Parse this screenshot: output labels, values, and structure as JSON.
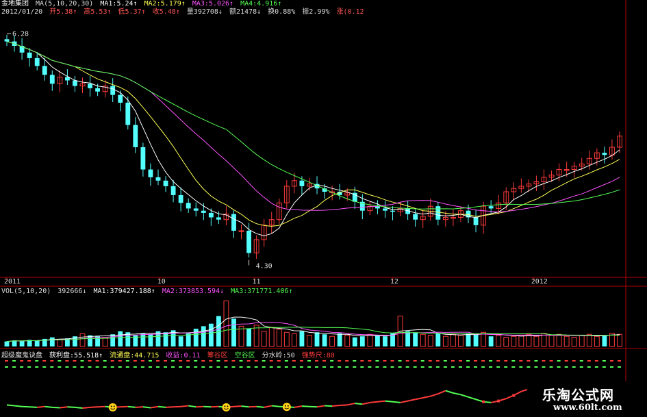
{
  "header": {
    "stock": "金地集团",
    "ma_label": "MA(5,10,20,30)",
    "ma1": "MA1:5.24↑",
    "ma2": "MA2:5.179↑",
    "ma3": "MA3:5.026↑",
    "ma4": "MA4:4.916↑",
    "date": "2012/01/20",
    "open": "开5.38↑",
    "high": "高5.53↑",
    "low": "低5.37↑",
    "close": "收5.48↑",
    "volume": "量392708↓",
    "amount": "额21478↓",
    "turnover": "换0.88%",
    "amplitude": "振2.99%",
    "change": "涨(0.12"
  },
  "vol_header": {
    "label": "VOL(5,10,20)",
    "value": "392666↓",
    "ma1": "MA1:379427.188↑",
    "ma2": "MA2:373853.594↓",
    "ma3": "MA3:371771.406↑"
  },
  "ind_header": {
    "name": "超级魔鬼诀盘",
    "profit": "获利盘:55.518↑",
    "float": "流通盘:44.715",
    "yield": "收益:0.11",
    "zone1": "筹谷区",
    "zone2": "空谷区",
    "ridge": "分水岭:50",
    "strong": "强势尺:80"
  },
  "watermark": {
    "title": "乐淘公式网",
    "url": "www.60lt.com"
  },
  "colors": {
    "up": "#ff3b3b",
    "down": "#54ffff",
    "ma1": "#ffffff",
    "ma2": "#ffff55",
    "ma3": "#ff55ff",
    "ma4": "#55ff55",
    "axis": "#b00000"
  },
  "chart_data": [
    {
      "type": "candlestick",
      "title": "",
      "x_ticks": [
        "2011",
        "10",
        "11",
        "12",
        "2012"
      ],
      "annotations": [
        {
          "text": "6.28"
        },
        {
          "text": "4.30"
        }
      ],
      "ylim": [
        4.1,
        6.4
      ],
      "close": [
        6.2,
        6.16,
        6.1,
        6.05,
        5.98,
        5.9,
        5.82,
        5.88,
        5.85,
        5.8,
        5.82,
        5.78,
        5.75,
        5.8,
        5.72,
        5.65,
        5.45,
        5.25,
        5.05,
        4.98,
        4.95,
        4.9,
        4.82,
        4.75,
        4.7,
        4.68,
        4.66,
        4.62,
        4.6,
        4.65,
        4.5,
        4.5,
        4.3,
        4.42,
        4.55,
        4.6,
        4.75,
        4.9,
        4.95,
        4.9,
        4.92,
        4.88,
        4.85,
        4.85,
        4.82,
        4.84,
        4.76,
        4.68,
        4.72,
        4.7,
        4.68,
        4.67,
        4.7,
        4.65,
        4.6,
        4.63,
        4.72,
        4.6,
        4.62,
        4.62,
        4.68,
        4.62,
        4.55,
        4.72,
        4.7,
        4.75,
        4.85,
        4.88,
        4.9,
        4.92,
        4.94,
        4.98,
        5.0,
        5.05,
        5.05,
        5.08,
        5.1,
        5.15,
        5.2,
        5.18,
        5.25,
        5.35
      ],
      "ma_series": [
        {
          "name": "MA1"
        },
        {
          "name": "MA2"
        },
        {
          "name": "MA3"
        },
        {
          "name": "MA4"
        }
      ]
    },
    {
      "type": "bar",
      "title": "",
      "ylim": [
        0,
        1.0
      ],
      "values": [
        0.1,
        0.12,
        0.11,
        0.13,
        0.12,
        0.15,
        0.18,
        0.14,
        0.16,
        0.2,
        0.25,
        0.22,
        0.2,
        0.18,
        0.24,
        0.3,
        0.28,
        0.22,
        0.26,
        0.24,
        0.3,
        0.28,
        0.32,
        0.2,
        0.26,
        0.35,
        0.4,
        0.45,
        0.6,
        0.9,
        0.55,
        0.4,
        0.35,
        0.42,
        0.3,
        0.38,
        0.34,
        0.28,
        0.25,
        0.3,
        0.22,
        0.28,
        0.24,
        0.2,
        0.26,
        0.22,
        0.18,
        0.2,
        0.24,
        0.22,
        0.2,
        0.26,
        0.6,
        0.3,
        0.28,
        0.24,
        0.22,
        0.26,
        0.2,
        0.24,
        0.22,
        0.26,
        0.24,
        0.28,
        0.2,
        0.22,
        0.18,
        0.2,
        0.22,
        0.24,
        0.2,
        0.26,
        0.22,
        0.24,
        0.2,
        0.18,
        0.22,
        0.24,
        0.2,
        0.22,
        0.26,
        0.24
      ]
    },
    {
      "type": "line",
      "title": "",
      "ylim": [
        0,
        1.0
      ],
      "values": [
        0.2,
        0.18,
        0.16,
        0.15,
        0.14,
        0.16,
        0.14,
        0.13,
        0.15,
        0.14,
        0.12,
        0.14,
        0.15,
        0.16,
        0.14,
        0.15,
        0.16,
        0.14,
        0.15,
        0.13,
        0.16,
        0.14,
        0.15,
        0.16,
        0.18,
        0.15,
        0.16,
        0.15,
        0.16,
        0.14,
        0.16,
        0.17,
        0.15,
        0.16,
        0.14,
        0.18,
        0.16,
        0.15,
        0.14,
        0.17,
        0.16,
        0.15,
        0.18,
        0.17,
        0.19,
        0.2,
        0.24,
        0.22,
        0.26,
        0.28,
        0.3,
        0.28,
        0.26,
        0.3,
        0.34,
        0.38,
        0.42,
        0.48,
        0.56,
        0.5,
        0.46,
        0.4,
        0.34,
        0.28,
        0.26,
        0.3,
        0.36,
        0.44,
        0.54,
        0.6,
        0.62,
        0.56,
        0.6,
        0.66,
        0.58,
        0.62,
        0.66,
        0.62,
        0.68,
        0.64,
        0.66,
        0.64
      ]
    }
  ]
}
